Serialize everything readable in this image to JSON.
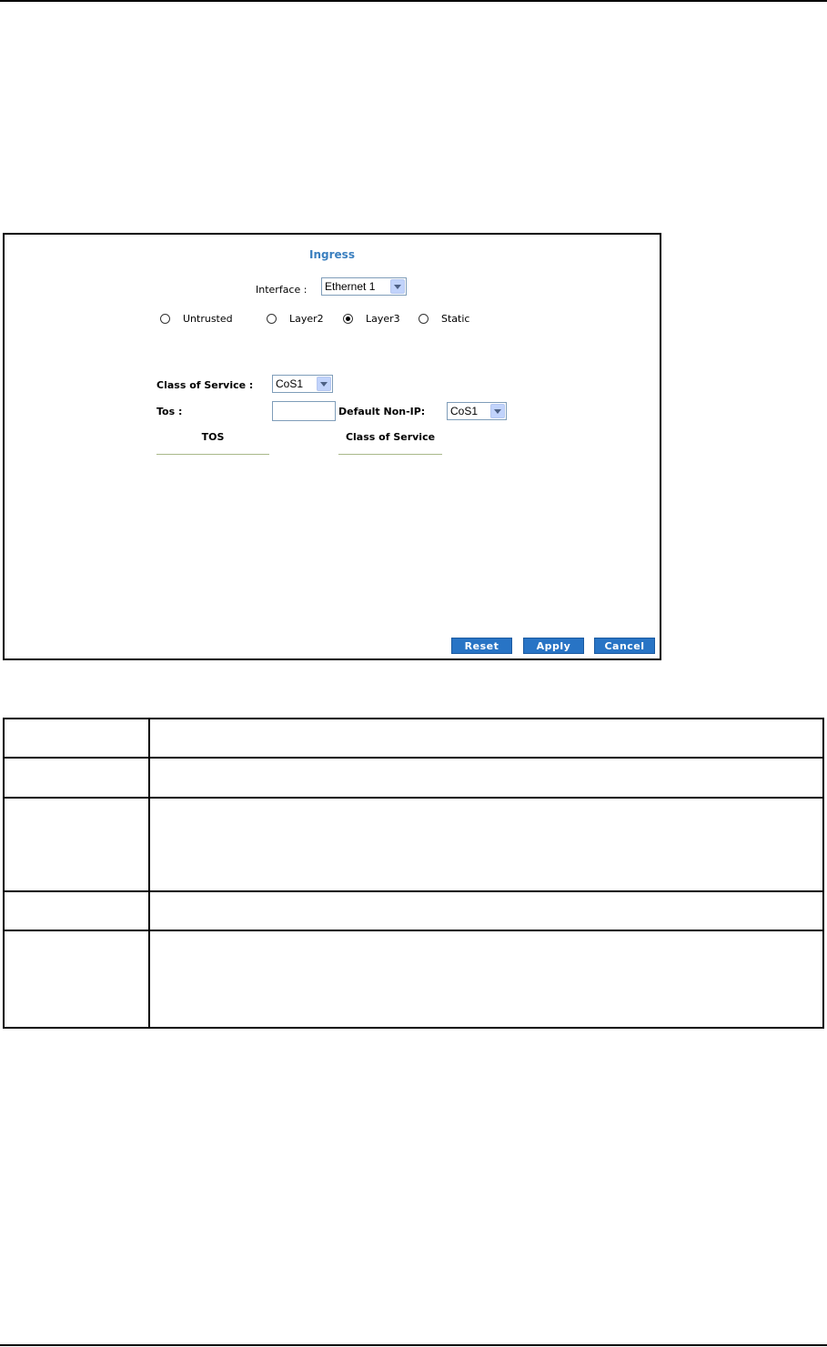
{
  "panel": {
    "title": "Ingress",
    "interface_label": "Interface :",
    "interface_value": "Ethernet 1",
    "trust_modes": [
      {
        "label": "Untrusted",
        "selected": false
      },
      {
        "label": "Layer2",
        "selected": false
      },
      {
        "label": "Layer3",
        "selected": true
      },
      {
        "label": "Static",
        "selected": false
      }
    ],
    "class_of_service_label": "Class of Service :",
    "class_of_service_value": "CoS1",
    "tos_label": "Tos :",
    "tos_value": "",
    "default_non_ip_label": "Default Non-IP:",
    "default_non_ip_value": "CoS1",
    "table_headers": [
      "TOS",
      "Class of Service"
    ],
    "buttons": {
      "reset": "Reset",
      "apply": "Apply",
      "cancel": "Cancel"
    }
  },
  "colors": {
    "title": "#3a7fbf",
    "button": "#2874c5"
  },
  "description_table": {
    "rows": 5
  }
}
